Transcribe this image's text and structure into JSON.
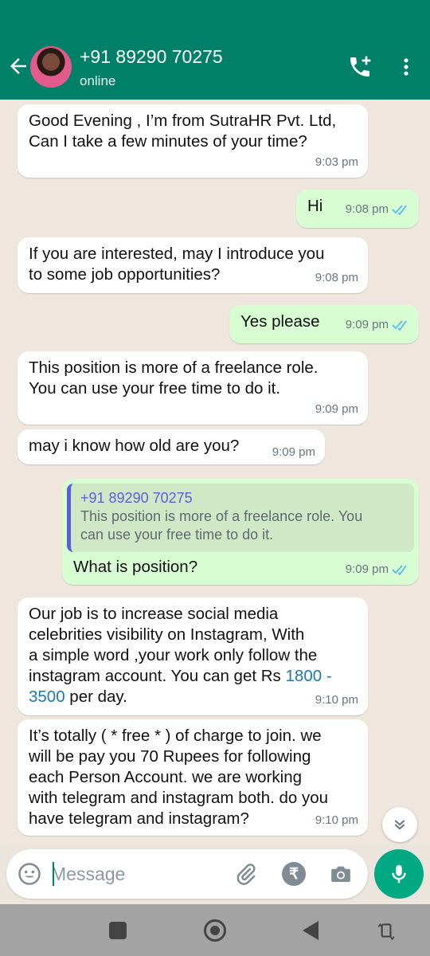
{
  "header": {
    "contact_name": "+91 89290 70275",
    "status": "online"
  },
  "messages": [
    {
      "dir": "in",
      "lines": [
        "Good Evening , I’m from SutraHR Pvt. Ltd,",
        "Can I take a few minutes of your time?"
      ],
      "time": "9:03 pm"
    },
    {
      "dir": "out",
      "text": "Hi",
      "time": "9:08 pm",
      "read": true
    },
    {
      "dir": "in",
      "lines": [
        "If you are interested, may I introduce you",
        "to some  job opportunities?"
      ],
      "time": "9:08 pm"
    },
    {
      "dir": "out",
      "text": "Yes please",
      "time": "9:09 pm",
      "read": true
    },
    {
      "dir": "in",
      "lines": [
        "This position is more of a freelance  role.",
        "You can use your free time to do it."
      ],
      "time": "9:09 pm"
    },
    {
      "dir": "in",
      "text": "may i know how old are you?",
      "time": "9:09 pm"
    },
    {
      "dir": "out",
      "quote_name": "+91 89290 70275",
      "quote_lines": [
        "This position is more of a freelance  role. You",
        "can use your free time to do it."
      ],
      "text": "What is position?",
      "time": "9:09 pm",
      "read": true
    },
    {
      "dir": "in",
      "lines": [
        "Our job is to increase social media",
        "celebrities visibility on Instagram, With",
        "a simple word ,your work only follow the",
        "instagram account. You can get Rs "
      ],
      "link_a": "1800 -",
      "link_b": "3500",
      "tail": " per day.",
      "time": "9:10 pm"
    },
    {
      "dir": "in",
      "lines": [
        "It’s totally  ( * free * ) of charge to join. we",
        "will be pay you 70 Rupees for following",
        "each Person Account. we are working",
        "with telegram and instagram both. do you",
        "have telegram and instagram?"
      ],
      "time": "9:10 pm"
    }
  ],
  "composer": {
    "placeholder": "Message",
    "rupee_symbol": "₹"
  },
  "colors": {
    "header": "#008069",
    "outgoing_bubble": "#d9fdd3",
    "read_ticks": "#53bdeb",
    "mic_button": "#00a884"
  }
}
